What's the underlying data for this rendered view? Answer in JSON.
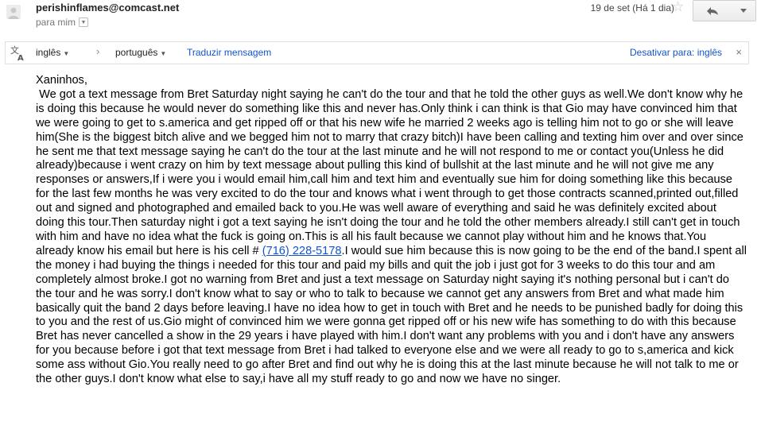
{
  "header": {
    "sender": "perishinflames@comcast.net",
    "to_label": "para mim",
    "date": "19 de set (Há 1 dia)"
  },
  "icons": {
    "avatar": "person-icon",
    "star": "star-icon",
    "reply": "reply-icon",
    "more": "dropdown-icon",
    "translate": "translate-icon",
    "close": "close-icon"
  },
  "translate_bar": {
    "source_lang": "inglês",
    "target_lang": "português",
    "translate_link": "Traduzir mensagem",
    "disable_link": "Desativar para: inglês",
    "close": "×"
  },
  "message": {
    "greeting": "Xaninhos,",
    "part1": " We got a text message from Bret Saturday night saying he can't do the tour and that he told the other guys as well.We don't know why he is doing this because he would never do something like this and never has.Only think i can think is that Gio may have convinced him that we were going to get to s.america and get ripped off or that his new wife he married 2 weeks ago is telling him not to go or she will leave him(She is the biggest bitch alive and we begged him not to marry that crazy bitch)I have been calling and texting him over and over since he sent me that text message saying he can't do the tour at the last minute and he will not respond to me or contact you(Unless he did already)because i went crazy on him by text message about pulling this kind of bullshit at the last minute and he will not give me any responses or answers,If i were you i would email him,call him and text him and eventually sue him for doing something like this because for the last few months he was very excited to do the tour and knows what i went through to get those contracts scanned,printed out,filled out and signed and photographed and emailed back to you.He was well aware of everything and said he was definitely excited about doing this tour.Then saturday night i got a text saying he isn't doing the tour and he told the other members already.I still can't get in touch with him and have no idea what the fuck is going on.This is all his fault because we cannot play without him and he knows that.You already know his email but here is his cell # ",
    "phone": "(716) 228-5178",
    "part2": ".I would sue him because this is now going to be the end of the band.I spent all the money i had buying the things i needed for this tour and paid my bills and quit the job i just got for 3 weeks to do this tour and am completely almost broke.I got no warning from Bret and just a text message on Saturday night saying it's nothing personal but i can't do the tour and he was sorry.I don't know what to say or who to talk to because we cannot get any answers from Bret and what made him basically quit the band 2 days before leaving.I have no idea how to get in touch with Bret and he needs to be punished badly for doing this to you and the rest of us.Gio might of convinced him we were gonna get ripped off or his new wife has something to do with this because Bret has never cancelled a show in the 29 years i have played with him.I don't want any problems with you and i don't have any answers for you because before i got that text message from Bret i had talked to everyone else and we were all ready to go to s,america and kick some ass without Gio.You really need to go after Bret and find out why he is doing this at the last minute because he will not talk to me or the other guys.I don't know what else to say,i have all my stuff ready to go and now we have no singer."
  },
  "colors": {
    "link": "#1155cc",
    "muted": "#777777",
    "border": "#e0e0e0"
  }
}
